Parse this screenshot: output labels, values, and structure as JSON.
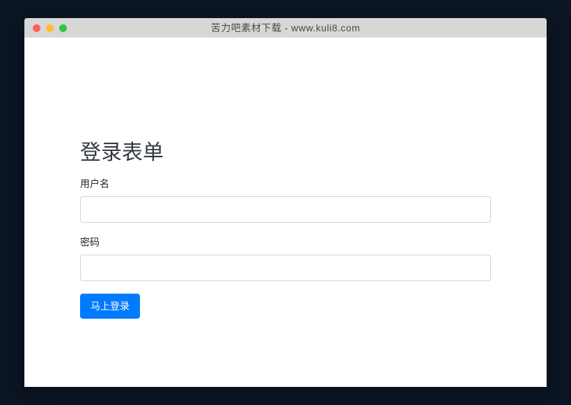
{
  "window": {
    "title": "苦力吧素材下载 - www.kuli8.com"
  },
  "form": {
    "title": "登录表单",
    "username_label": "用户名",
    "username_value": "",
    "password_label": "密码",
    "password_value": "",
    "submit_label": "马上登录"
  }
}
